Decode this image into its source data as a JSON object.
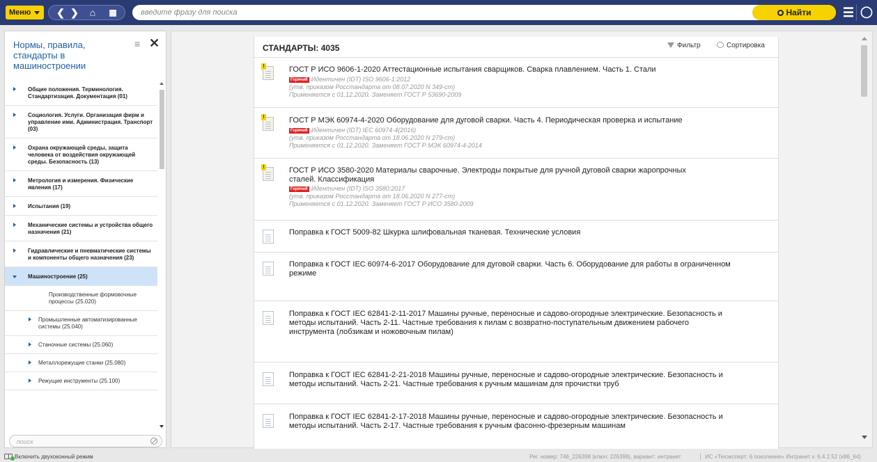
{
  "topbar": {
    "menu_label": "Меню",
    "search_placeholder": "введите фразу для поиска",
    "find_label": "Найти"
  },
  "sidebar": {
    "title": "Нормы, правила, стандарты в машиностроении",
    "search_placeholder": "поиск",
    "items": [
      {
        "label": "Общие положения. Терминология. Стандартизация. Документация (01)"
      },
      {
        "label": "Социология. Услуги. Организация фирм и управление ими. Администрация. Транспорт (03)"
      },
      {
        "label": "Охрана окружающей среды, защита человека от воздействия окружающей среды. Безопасность (13)"
      },
      {
        "label": "Метрология и измерения. Физические явления (17)"
      },
      {
        "label": "Испытания (19)"
      },
      {
        "label": "Механические системы и устройства общего назначения (21)"
      },
      {
        "label": "Гидравлические и пневматические системы и компоненты общего назначения (23)"
      },
      {
        "label": "Машиностроение (25)"
      }
    ],
    "subitems": [
      {
        "label": "Производственные формовочные процессы (25.020)"
      },
      {
        "label": "Промышленные автоматизированные системы (25.040)"
      },
      {
        "label": "Станочные системы (25.060)"
      },
      {
        "label": "Металлорежущие станки (25.080)"
      },
      {
        "label": "Режущие инструменты (25.100)"
      }
    ]
  },
  "main": {
    "header_title": "СТАНДАРТЫ: 4035",
    "filter_label": "Фильтр",
    "sort_label": "Сортировка",
    "documents": [
      {
        "title": "ГОСТ Р ИСО 9606-1-2020 Аттестационные испытания сварщиков. Сварка плавлением. Часть 1. Стали",
        "badge": "Горячий",
        "identity": "Идентичен (IDT) ISO 9606-1:2012",
        "approved": "(утв. приказом Росстандарта от 08.07.2020 N 349-ст)",
        "applies": "Применяется с 01.12.2020. Заменяет ГОСТ Р 53690-2009"
      },
      {
        "title": "ГОСТ Р МЭК 60974-4-2020 Оборудование для дуговой сварки. Часть 4. Периодическая проверка и испытание",
        "badge": "Горячий",
        "identity": "Идентичен (IDT) IEC 60974-4(2016)",
        "approved": "(утв. приказом Росстандарта от 18.06.2020 N 279-ст)",
        "applies": "Применяется с 01.12.2020. Заменяет ГОСТ Р МЭК 60974-4-2014"
      },
      {
        "title": "ГОСТ Р ИСО 3580-2020 Материалы сварочные. Электроды покрытые для ручной дуговой сварки жаропрочных сталей. Классификация",
        "badge": "Горячий",
        "identity": "Идентичен (IDT) ISO 3580:2017",
        "approved": "(утв. приказом Росстандарта от 18.06.2020 N 277-ст)",
        "applies": "Применяется с 01.12.2020. Заменяет ГОСТ Р ИСО 3580-2009"
      },
      {
        "title": "Поправка к ГОСТ 5009-82 Шкурка шлифовальная тканевая. Технические условия"
      },
      {
        "title": "Поправка к ГОСТ IEC 60974-6-2017 Оборудование для дуговой сварки. Часть 6. Оборудование для работы в ограниченном режиме"
      },
      {
        "title": "Поправка к ГОСТ IEC 62841-2-11-2017 Машины ручные, переносные и садово-огородные электрические. Безопасность и методы испытаний. Часть 2-11. Частные требования к пилам с возвратно-поступательным движением рабочего инструмента (лобзикам и ножовочным пилам)"
      },
      {
        "title": "Поправка к ГОСТ IEC 62841-2-21-2018 Машины ручные, переносные и садово-огородные электрические. Безопасность и методы испытаний. Часть 2-21. Частные требования к ручным машинам для прочистки труб"
      },
      {
        "title": "Поправка к ГОСТ IEC 62841-2-17-2018 Машины ручные, переносные и садово-огородные электрические. Безопасность и методы испытаний. Часть 2-17. Частные требования к ручным фасонно-фрезерным машинам"
      }
    ]
  },
  "statusbar": {
    "dual_window_label": "Включить двухоконный режим",
    "reg_info": "Рег. номер: 746_226398 (ключ: 226398), вариант: интранет",
    "version_info": "ИС «Техэксперт: 6 поколение» Интранет v. 6.4.2.52 (x86_64)"
  }
}
